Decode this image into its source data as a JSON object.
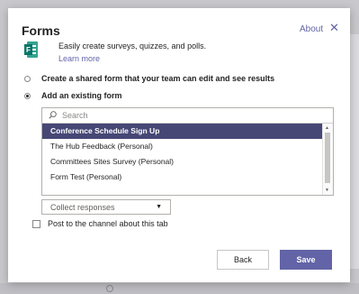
{
  "dialog": {
    "title": "Forms",
    "about_label": "About",
    "close_glyph": "✕",
    "app_icon": "forms-logo-icon",
    "description": "Easily create surveys, quizzes, and polls.",
    "learn_more": "Learn more",
    "option_create": "Create a shared form that your team can edit and see results",
    "option_existing": "Add an existing form",
    "selected_option": "existing"
  },
  "forms_list": {
    "search_placeholder": "Search",
    "items": [
      {
        "label": "Conference Schedule Sign Up",
        "selected": true
      },
      {
        "label": "The Hub Feedback (Personal)",
        "selected": false
      },
      {
        "label": "Committees Sites Survey (Personal)",
        "selected": false
      },
      {
        "label": "Form Test (Personal)",
        "selected": false
      }
    ]
  },
  "mode_select": {
    "value": "Collect responses"
  },
  "post_checkbox": {
    "label": "Post to the channel about this tab",
    "checked": false
  },
  "buttons": {
    "back": "Back",
    "save": "Save"
  },
  "colors": {
    "accent": "#6264a7",
    "selected_row": "#464775",
    "forms_green": "#077568"
  }
}
